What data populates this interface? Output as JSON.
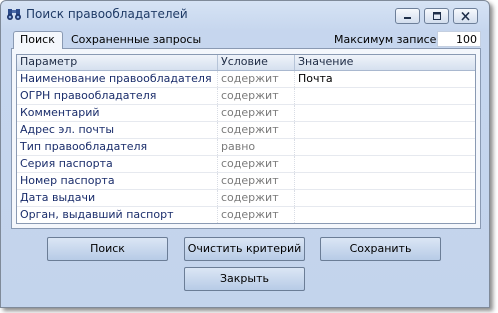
{
  "window": {
    "title": "Поиск правообладателей",
    "icon": "binoculars-icon"
  },
  "title_buttons": {
    "minimize": "minimize-icon",
    "maximize": "maximize-icon",
    "close": "close-icon"
  },
  "tabs": [
    {
      "label": "Поиск",
      "active": true
    },
    {
      "label": "Сохраненные запросы",
      "active": false
    }
  ],
  "max_records": {
    "label": "Максимум записей:",
    "value": "100"
  },
  "grid": {
    "columns": [
      "Параметр",
      "Условие",
      "Значение"
    ],
    "rows": [
      {
        "param": "Наименование правообладателя",
        "condition": "содержит",
        "value": "Почта"
      },
      {
        "param": "ОГРН правообладателя",
        "condition": "содержит",
        "value": ""
      },
      {
        "param": "Комментарий",
        "condition": "содержит",
        "value": ""
      },
      {
        "param": "Адрес эл. почты",
        "condition": "содержит",
        "value": ""
      },
      {
        "param": "Тип правообладателя",
        "condition": "равно",
        "value": ""
      },
      {
        "param": "Серия паспорта",
        "condition": "содержит",
        "value": ""
      },
      {
        "param": "Номер паспорта",
        "condition": "содержит",
        "value": ""
      },
      {
        "param": "Дата выдачи",
        "condition": "содержит",
        "value": ""
      },
      {
        "param": "Орган, выдавший паспорт",
        "condition": "содержит",
        "value": ""
      }
    ]
  },
  "buttons": {
    "search": "Поиск",
    "clear": "Очистить критерий",
    "save": "Сохранить",
    "close": "Закрыть"
  }
}
